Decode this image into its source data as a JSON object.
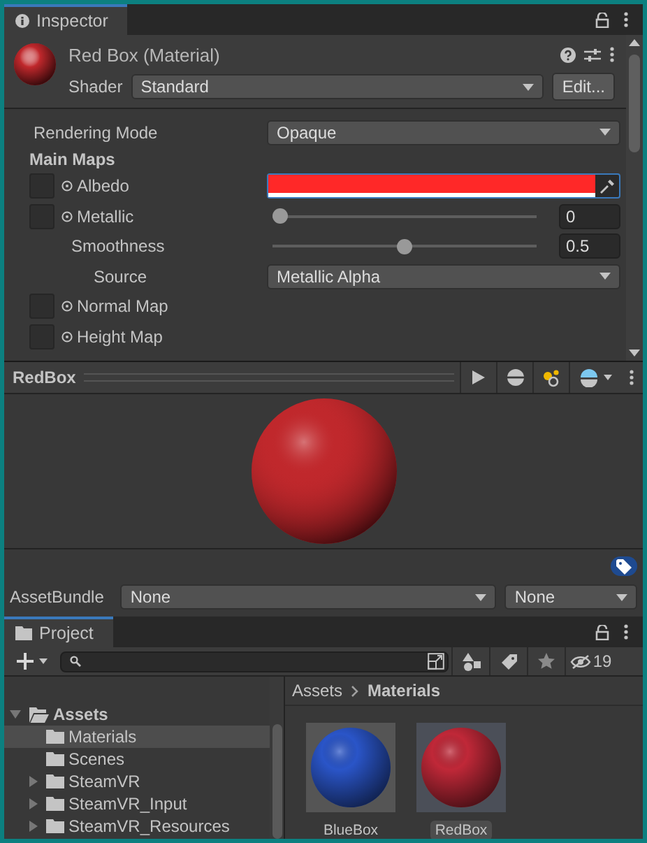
{
  "inspector": {
    "tab": "Inspector",
    "material_title": "Red Box (Material)",
    "shader": {
      "label": "Shader",
      "value": "Standard"
    },
    "edit_button": "Edit...",
    "properties": [
      {
        "kind": "dropdown",
        "label": "Rendering Mode",
        "value": "Opaque"
      },
      {
        "kind": "heading",
        "label": "Main Maps"
      },
      {
        "kind": "color",
        "label": "Albedo",
        "slot": true,
        "color": "#ff2828"
      },
      {
        "kind": "slider",
        "label": "Metallic",
        "slot": true,
        "level": 0,
        "value": "0",
        "children": [
          {
            "kind": "slider",
            "label": "Smoothness",
            "level": 0.5,
            "value": "0.5",
            "children": [
              {
                "kind": "dropdown",
                "label": "Source",
                "value": "Metallic Alpha"
              }
            ]
          }
        ]
      },
      {
        "kind": "texture",
        "label": "Normal Map",
        "slot": true
      },
      {
        "kind": "texture",
        "label": "Height Map",
        "slot": true
      }
    ]
  },
  "preview": {
    "name": "RedBox"
  },
  "asset_bundle": {
    "label": "AssetBundle",
    "name": "None",
    "variant": "None"
  },
  "project": {
    "tab": "Project",
    "hidden_count": "19",
    "tree": [
      {
        "label": "Assets",
        "expanded": true,
        "children": [
          {
            "label": "Materials",
            "selected": true
          },
          {
            "label": "Scenes",
            "selected": false
          },
          {
            "label": "SteamVR",
            "selected": false,
            "expandable": true
          },
          {
            "label": "SteamVR_Input",
            "selected": false,
            "expandable": true
          },
          {
            "label": "SteamVR_Resources",
            "selected": false,
            "expandable": true
          }
        ]
      }
    ],
    "breadcrumb": [
      "Assets",
      "Materials"
    ],
    "assets": [
      {
        "name": "BlueBox",
        "color": "#2a55c8",
        "selected": false
      },
      {
        "name": "RedBox",
        "color": "#c02838",
        "selected": true
      }
    ]
  }
}
